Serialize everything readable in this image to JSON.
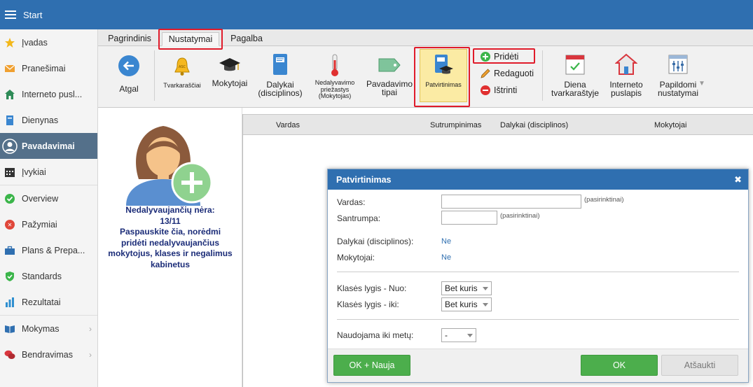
{
  "app": {
    "title": "Start"
  },
  "sidebar": {
    "items": [
      {
        "label": "Įvadas"
      },
      {
        "label": "Pranešimai"
      },
      {
        "label": "Interneto pusl..."
      },
      {
        "label": "Dienynas"
      },
      {
        "label": "Pavadavimai"
      },
      {
        "label": "Įvykiai"
      },
      {
        "label": "Overview"
      },
      {
        "label": "Pažymiai"
      },
      {
        "label": "Plans & Prepa..."
      },
      {
        "label": "Standards"
      },
      {
        "label": "Rezultatai"
      },
      {
        "label": "Mokymas"
      },
      {
        "label": "Bendravimas"
      }
    ]
  },
  "ribbon": {
    "tabs": [
      "Pagrindinis",
      "Nustatymai",
      "Pagalba"
    ],
    "buttons": {
      "back": "Atgal",
      "timetables": "Tvarkaraščiai",
      "teachers": "Mokytojai",
      "subjects": "Dalykai\n(disciplinos)",
      "absence_reason": "Nedalyvavimo\npriežastys\n(Mokytojas)",
      "substitution_types": "Pavadavimo\ntipai",
      "confirmations": "Patvirtinimas",
      "add": "Pridėti",
      "edit": "Redaguoti",
      "delete": "Ištrinti",
      "day_timetable": "Diena\ntvarkaraštyje",
      "website": "Interneto\npuslapis",
      "extra_settings": "Papildomi\nnustatymai"
    }
  },
  "info_panel": {
    "line1": "Nedalyvaujančių nėra:",
    "line2": "13/11",
    "line3": "Paspauskite čia, norėdmi",
    "line4": "pridėti nedalyvaujančius",
    "line5": "mokytojus, klases ir negalimus",
    "line6": "kabinetus"
  },
  "table": {
    "columns": [
      "Vardas",
      "Sutrumpinimas",
      "Dalykai (disciplinos)",
      "Mokytojai"
    ]
  },
  "dialog": {
    "title": "Patvirtinimas",
    "name_label": "Vardas:",
    "name_value": "",
    "optional": "(pasirinktinai)",
    "abbr_label": "Santrumpa:",
    "abbr_value": "",
    "subjects_label": "Dalykai (disciplinos):",
    "subjects_value": "Ne",
    "teachers_label": "Mokytojai:",
    "teachers_value": "Ne",
    "level_from_label": "Klasės lygis - Nuo:",
    "level_from_value": "Bet kuris",
    "level_to_label": "Klasės lygis - iki:",
    "level_to_value": "Bet kuris",
    "used_until_label": "Naudojama iki metų:",
    "used_until_value": "-",
    "btn_ok_new": "OK + Nauja",
    "btn_ok": "OK",
    "btn_cancel": "Atšaukti"
  },
  "colors": {
    "accent": "#2f6fb0",
    "highlight": "#e01b2a",
    "ok": "#4cae4c",
    "sidebar_active": "#54708a"
  }
}
